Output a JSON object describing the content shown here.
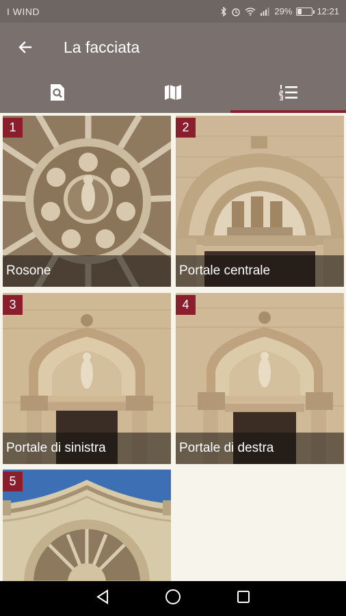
{
  "status": {
    "carrier": "I WIND",
    "battery_percent": "29%",
    "battery_level": 0.29,
    "time": "12:21",
    "icons": [
      "bluetooth-icon",
      "alarm-icon",
      "wifi-icon",
      "signal-icon",
      "battery-icon"
    ]
  },
  "header": {
    "back_icon": "arrow-left-icon",
    "title": "La facciata"
  },
  "tabs": [
    {
      "icon": "search-document-icon",
      "active": false
    },
    {
      "icon": "map-icon",
      "active": false
    },
    {
      "icon": "numbered-list-icon",
      "active": true
    }
  ],
  "items": [
    {
      "number": "1",
      "label": "Rosone"
    },
    {
      "number": "2",
      "label": "Portale centrale"
    },
    {
      "number": "3",
      "label": "Portale di sinistra"
    },
    {
      "number": "4",
      "label": "Portale di destra"
    },
    {
      "number": "5",
      "label": ""
    }
  ],
  "nav": [
    "back-triangle-icon",
    "home-circle-icon",
    "recents-square-icon"
  ],
  "colors": {
    "app_bar": "#7a716e",
    "status_bar": "#6e6663",
    "accent": "#8b1e2c",
    "background": "#f7f4ec"
  }
}
